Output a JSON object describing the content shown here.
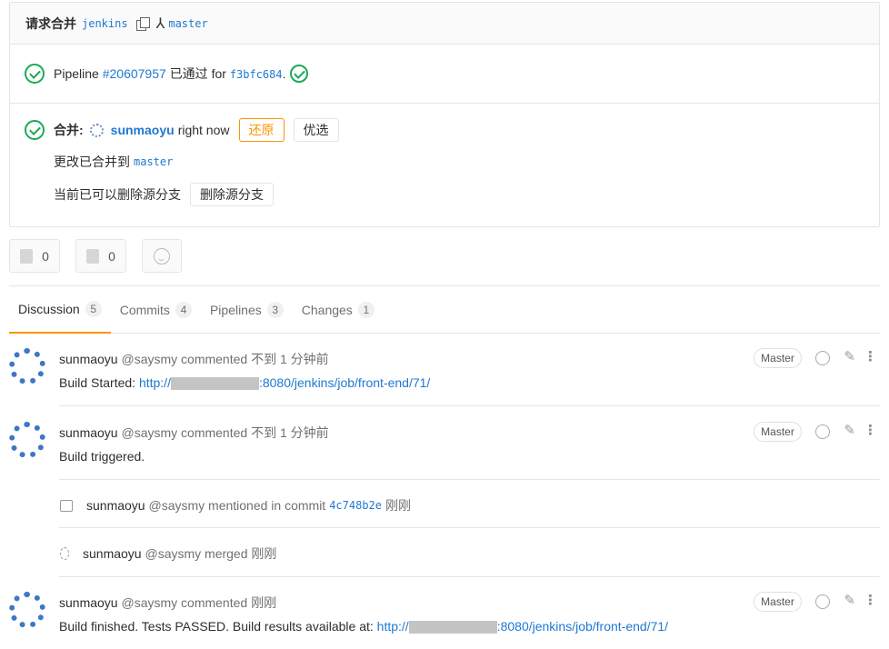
{
  "header": {
    "title": "请求合并",
    "source_branch": "jenkins",
    "arrow": "⅄",
    "target_branch": "master"
  },
  "pipeline": {
    "prefix": "Pipeline",
    "id": "#20607957",
    "status_text": "已通过 for",
    "sha": "f3bfc684",
    "suffix": "."
  },
  "merged": {
    "label": "合并:",
    "user": "sunmaoyu",
    "time": "right now",
    "revert_label": "还原",
    "cherry_label": "优选",
    "changes_text": "更改已合并到",
    "changes_branch": "master",
    "delete_text": "当前已可以删除源分支",
    "delete_button": "删除源分支"
  },
  "awards": {
    "thumbs_up_count": "0",
    "thumbs_down_count": "0"
  },
  "tabs": [
    {
      "label": "Discussion",
      "count": "5"
    },
    {
      "label": "Commits",
      "count": "4"
    },
    {
      "label": "Pipelines",
      "count": "3"
    },
    {
      "label": "Changes",
      "count": "1"
    }
  ],
  "notes": [
    {
      "author": "sunmaoyu",
      "handle": "@saysmy commented",
      "time": "不到 1 分钟前",
      "role": "Master",
      "body_prefix": "Build Started: ",
      "link_prefix": "http://",
      "link_suffix": ":8080/jenkins/job/front-end/71/"
    },
    {
      "author": "sunmaoyu",
      "handle": "@saysmy commented",
      "time": "不到 1 分钟前",
      "role": "Master",
      "body": "Build triggered."
    },
    {
      "author": "sunmaoyu",
      "handle": "@saysmy commented",
      "time": "刚刚",
      "role": "Master",
      "body_prefix": "Build finished. Tests PASSED. Build results available at: ",
      "link_prefix": "http://",
      "link_suffix": ":8080/jenkins/job/front-end/71/"
    }
  ],
  "system_notes": [
    {
      "author": "sunmaoyu",
      "text": "@saysmy mentioned in commit",
      "sha": "4c748b2e",
      "time": "刚刚"
    },
    {
      "author": "sunmaoyu",
      "text": "@saysmy merged",
      "time": "刚刚"
    }
  ],
  "icons": {
    "copy": "copy-icon",
    "check": "check-circle-icon",
    "thumbs_up": "thumbs-up-icon",
    "thumbs_down": "thumbs-down-icon",
    "emoji": "smiley-icon",
    "edit": "pencil-icon",
    "more": "kebab-icon",
    "comment": "comment-icon",
    "merge": "merge-icon"
  },
  "colors": {
    "success": "#1aaa55",
    "link": "#1f78d1",
    "warning": "#fc9403"
  }
}
